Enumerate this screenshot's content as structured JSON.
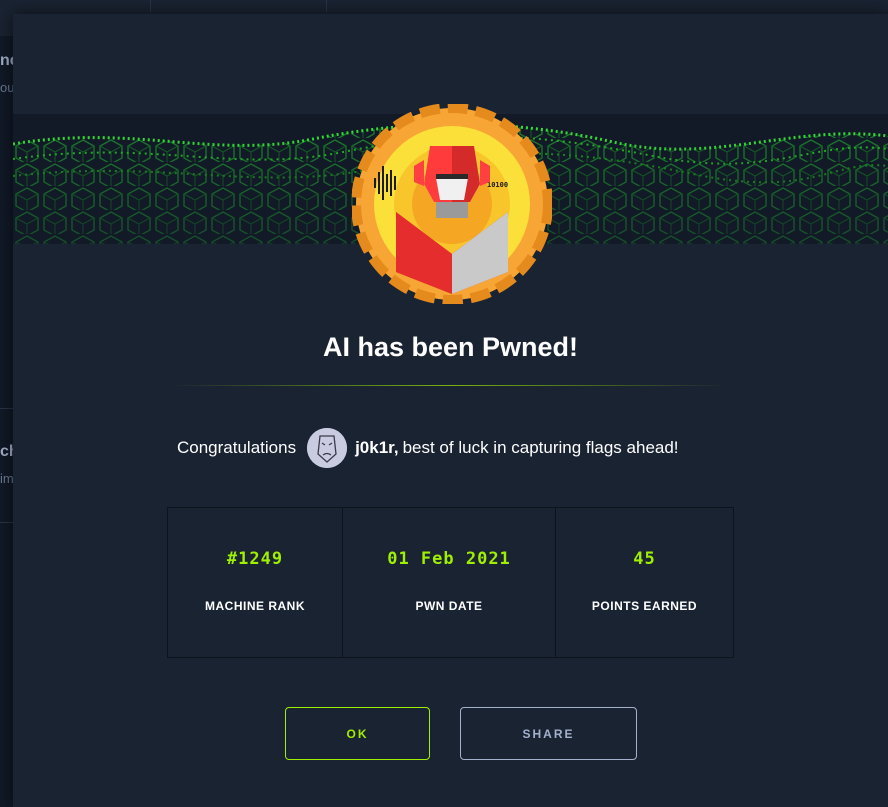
{
  "background": {
    "fragment_top": "nc",
    "fragment_top_sub": "ou",
    "fragment_mid": "ch",
    "fragment_mid_sub": "im"
  },
  "modal": {
    "title": "AI has been Pwned!",
    "congrats_prefix": "Congratulations",
    "username": "j0k1r,",
    "congrats_suffix": "best of luck in capturing flags ahead!",
    "machine_avatar_text": "10100",
    "stats": [
      {
        "value": "#1249",
        "label": "MACHINE RANK"
      },
      {
        "value": "01 Feb 2021",
        "label": "PWN DATE"
      },
      {
        "value": "45",
        "label": "POINTS EARNED"
      }
    ],
    "buttons": {
      "ok": "OK",
      "share": "SHARE"
    }
  },
  "colors": {
    "accent": "#9fef00",
    "modal_bg": "#1a2332",
    "text": "#ffffff",
    "muted": "#a4b1cd"
  },
  "icons": [
    "machine-avatar-robot-icon",
    "user-avatar-icon"
  ]
}
